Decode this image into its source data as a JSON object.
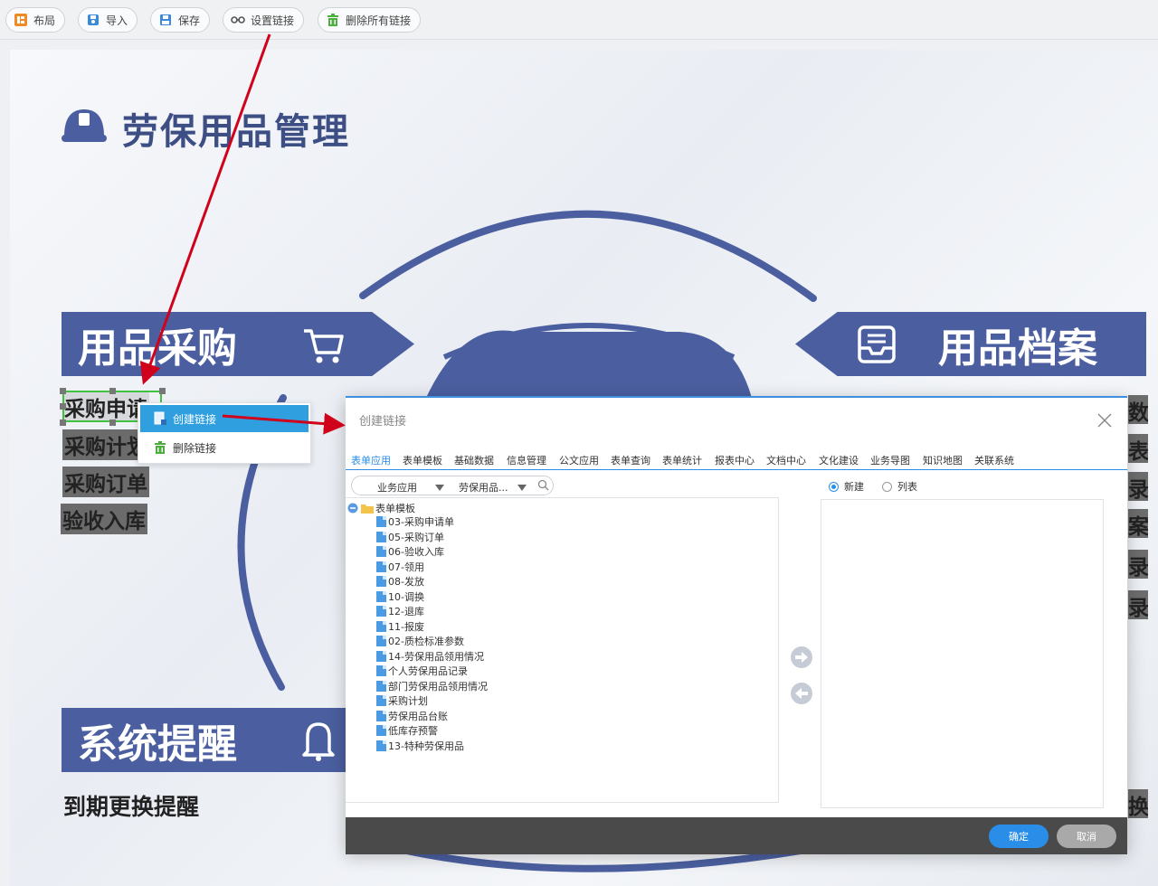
{
  "toolbar": {
    "layout": "布局",
    "import": "导入",
    "save": "保存",
    "set_link": "设置链接",
    "delete_all_links": "删除所有链接"
  },
  "canvas": {
    "title": "劳保用品管理",
    "banner_purchase": "用品采购",
    "banner_archive": "用品档案",
    "banner_reminder": "系统提醒",
    "purchase_items": [
      "采购申请",
      "采购计划",
      "采购订单",
      "验收入库"
    ],
    "reminder_item": "到期更换提醒",
    "right_cut_chars": [
      "数",
      "表",
      "录",
      "案",
      "录",
      "录",
      "换"
    ]
  },
  "context_menu": {
    "create_link": "创建链接",
    "delete_link": "删除链接"
  },
  "dialog": {
    "title": "创建链接",
    "tabs": [
      "表单应用",
      "表单模板",
      "基础数据",
      "信息管理",
      "公文应用",
      "表单查询",
      "表单统计",
      "报表中心",
      "文档中心",
      "文化建设",
      "业务导图",
      "知识地图",
      "关联系统"
    ],
    "active_tab": "表单应用",
    "filter": {
      "category": "业务应用",
      "app": "劳保用品..."
    },
    "tree_root": "表单模板",
    "tree_items": [
      "03-采购申请单",
      "05-采购订单",
      "06-验收入库",
      "07-领用",
      "08-发放",
      "10-调换",
      "12-退库",
      "11-报废",
      "02-质检标准参数",
      "14-劳保用品领用情况",
      "个人劳保用品记录",
      "部门劳保用品领用情况",
      "采购计划",
      "劳保用品台账",
      "低库存预警",
      "13-特种劳保用品"
    ],
    "radio_new": "新建",
    "radio_list": "列表",
    "confirm": "确定",
    "cancel": "取消"
  },
  "colors": {
    "brand": "#4b5fa0",
    "accent": "#2a8ee8",
    "annotation_arrow": "#d0021b",
    "selection": "#3fc23f"
  }
}
